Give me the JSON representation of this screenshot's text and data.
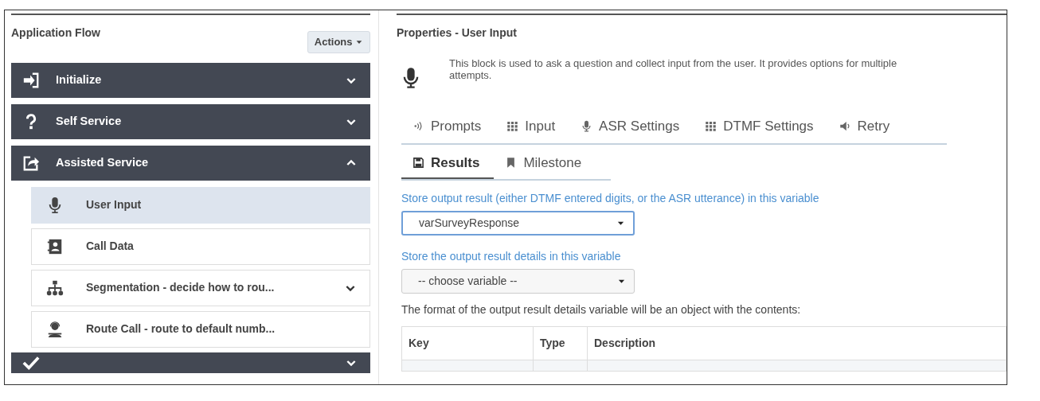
{
  "flow": {
    "title": "Application Flow",
    "actions_button": "Actions",
    "sections": [
      {
        "label": "Initialize",
        "expanded": false
      },
      {
        "label": "Self Service",
        "expanded": false
      },
      {
        "label": "Assisted Service",
        "expanded": true,
        "children": [
          {
            "label": "User Input",
            "selected": true,
            "expandable": false
          },
          {
            "label": "Call Data",
            "selected": false,
            "expandable": false
          },
          {
            "label": "Segmentation - decide how to rou...",
            "selected": false,
            "expandable": true
          },
          {
            "label": "Route Call - route to default numb...",
            "selected": false,
            "expandable": false
          }
        ]
      },
      {
        "expanded": false
      }
    ]
  },
  "properties": {
    "title": "Properties - User Input",
    "description": "This block is used to ask a question and collect input from the user. It provides options for multiple attempts.",
    "tab_rows": [
      [
        {
          "label": "Prompts",
          "selected": false
        },
        {
          "label": "Input",
          "selected": false
        },
        {
          "label": "ASR Settings",
          "selected": false
        },
        {
          "label": "DTMF Settings",
          "selected": false
        },
        {
          "label": "Retry",
          "selected": false
        }
      ],
      [
        {
          "label": "Results",
          "selected": true
        },
        {
          "label": "Milestone",
          "selected": false
        }
      ]
    ],
    "fields": [
      {
        "label": "Store output result (either DTMF entered digits, or the ASR utterance) in this variable",
        "value": "varSurveyResponse",
        "focused": true
      },
      {
        "label": "Store the output result details in this variable",
        "value": "-- choose variable --",
        "focused": false
      }
    ],
    "note": "The format of the output result details variable will be an object with the contents:",
    "table": {
      "columns": [
        "Key",
        "Type",
        "Description"
      ]
    }
  }
}
